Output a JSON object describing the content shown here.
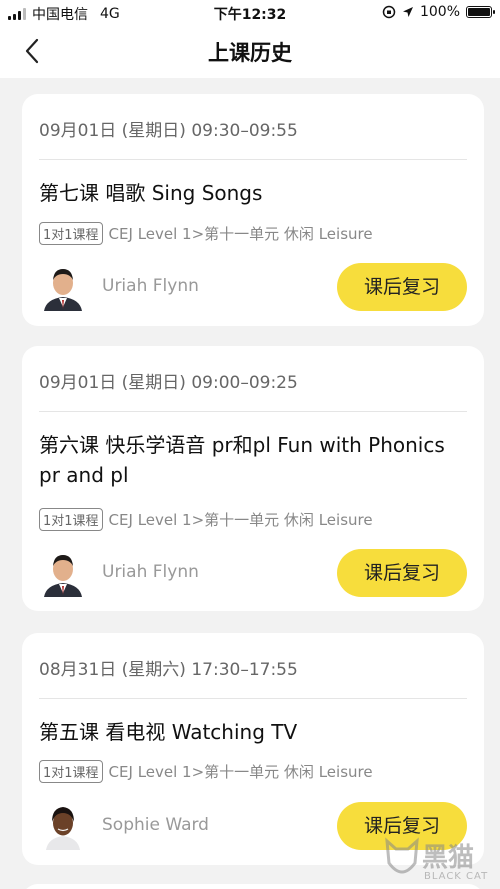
{
  "status_bar": {
    "carrier": "中国电信",
    "network": "4G",
    "time": "下午12:32",
    "battery": "100%",
    "battery_level": 1.0
  },
  "nav": {
    "title": "上课历史",
    "back_icon": "chevron-left-icon"
  },
  "classes": [
    {
      "time": "09月01日 (星期日) 09:30–09:55",
      "title": "第七课 唱歌 Sing Songs",
      "tag": "1对1课程",
      "course": "CEJ Level 1>第十一单元 休闲 Leisure",
      "teacher": "Uriah Flynn",
      "button": "课后复习"
    },
    {
      "time": "09月01日 (星期日) 09:00–09:25",
      "title": "第六课 快乐学语音 pr和pl Fun with Phonics pr and pl",
      "tag": "1对1课程",
      "course": "CEJ Level 1>第十一单元 休闲 Leisure",
      "teacher": "Uriah Flynn",
      "button": "课后复习"
    },
    {
      "time": "08月31日 (星期六) 17:30–17:55",
      "title": "第五课 看电视 Watching TV",
      "tag": "1对1课程",
      "course": "CEJ Level 1>第十一单元 休闲 Leisure",
      "teacher": "Sophie Ward",
      "button": "课后复习"
    }
  ],
  "watermark": {
    "text": "黑猫",
    "sub": "BLACK CAT"
  }
}
